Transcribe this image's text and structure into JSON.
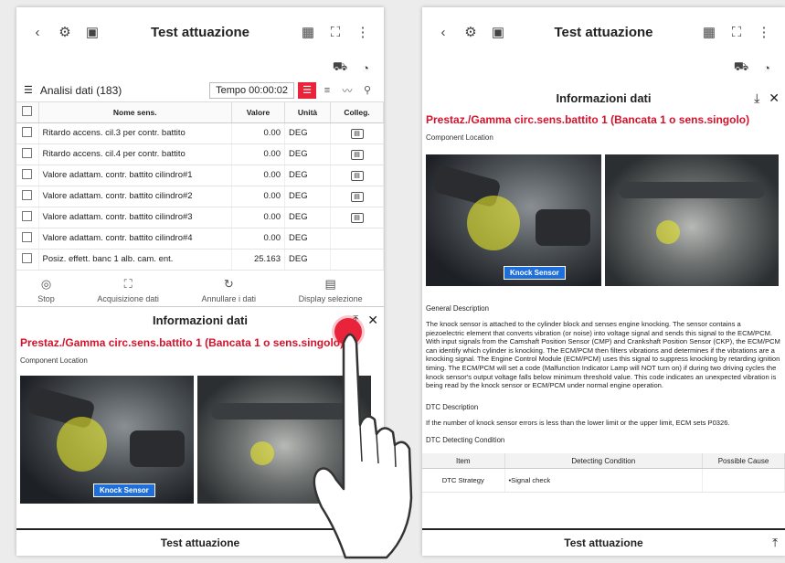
{
  "left": {
    "title": "Test attuazione",
    "data_header": {
      "label": "Analisi dati (183)",
      "time": "Tempo 00:00:02"
    },
    "columns": [
      "Nome sens.",
      "Valore",
      "Unità",
      "Colleg."
    ],
    "rows": [
      {
        "name": "Ritardo accens. cil.3 per contr. battito",
        "value": "0.00",
        "unit": "DEG"
      },
      {
        "name": "Ritardo accens. cil.4 per contr. battito",
        "value": "0.00",
        "unit": "DEG"
      },
      {
        "name": "Valore adattam. contr. battito cilindro#1",
        "value": "0.00",
        "unit": "DEG"
      },
      {
        "name": "Valore adattam. contr. battito cilindro#2",
        "value": "0.00",
        "unit": "DEG"
      },
      {
        "name": "Valore adattam. contr. battito cilindro#3",
        "value": "0.00",
        "unit": "DEG"
      },
      {
        "name": "Valore adattam. contr. battito cilindro#4",
        "value": "0.00",
        "unit": "DEG"
      },
      {
        "name": "Posiz. effett. banc 1 alb. cam. ent.",
        "value": "25.163",
        "unit": "DEG"
      }
    ],
    "toolbar": {
      "stop": "Stop",
      "capture": "Acquisizione dati",
      "cancel": "Annullare i dati",
      "display": "Display selezione"
    },
    "info": {
      "header": "Informazioni dati",
      "title": "Prestaz./Gamma circ.sens.battito 1 (Bancata 1 o sens.singolo)",
      "component_location": "Component Location",
      "knock_label": "Knock Sensor"
    },
    "bottom": "Test attuazione"
  },
  "right": {
    "title": "Test attuazione",
    "info": {
      "header": "Informazioni dati",
      "title": "Prestaz./Gamma circ.sens.battito 1 (Bancata 1 o sens.singolo)",
      "component_location": "Component Location",
      "knock_label": "Knock Sensor",
      "general_desc_title": "General Description",
      "general_desc": "The knock sensor is attached to the cylinder block and senses engine knocking. The sensor contains a piezoelectric element that converts vibration (or noise) into voltage signal and sends this signal to the ECM/PCM. With input signals from the Camshaft Position Sensor (CMP) and Crankshaft Position Sensor (CKP), the ECM/PCM can identify which cylinder is knocking. The ECM/PCM then filters vibrations and determines if the vibrations are a knocking signal. The Engine Control Module (ECM/PCM) uses this signal to suppress knocking by retarding ignition timing. The ECM/PCM will set a code (Malfunction Indicator Lamp will NOT turn on) if during two driving cycles the knock sensor's output voltage falls below minimum threshold value. This code indicates an unexpected vibration is being read by the knock sensor or ECM/PCM under normal engine operation.",
      "dtc_desc_title": "DTC Description",
      "dtc_desc": "If the number of knock sensor errors is less than the lower limit or the upper limit, ECM sets P0326.",
      "dtc_cond_title": "DTC Detecting Condition",
      "dtc_table": {
        "headers": [
          "Item",
          "Detecting Condition",
          "Possible Cause"
        ],
        "row": {
          "item": "DTC Strategy",
          "condition": "•Signal check",
          "cause": ""
        }
      }
    },
    "bottom": "Test attuazione"
  },
  "colors": {
    "accent": "#e9243a",
    "red_title": "#d8112b",
    "knock_label_bg": "#1e6fd9"
  }
}
